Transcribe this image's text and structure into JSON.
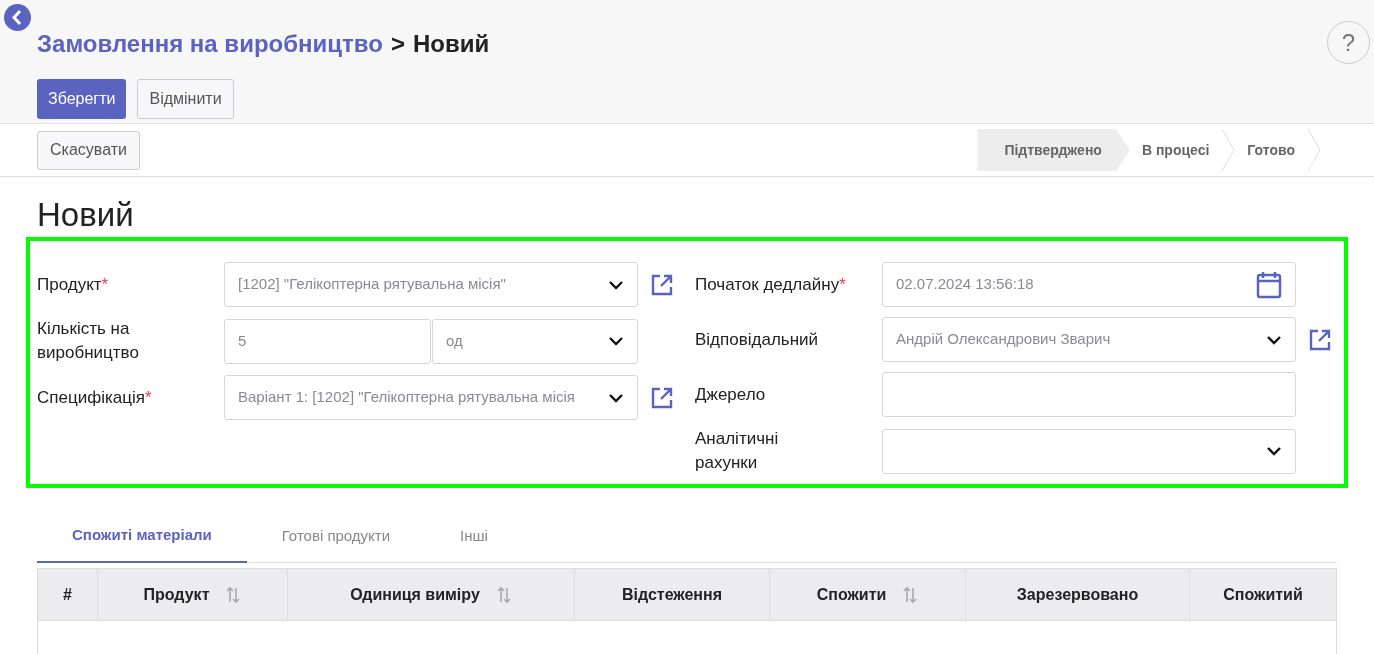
{
  "breadcrumb": {
    "parent": "Замовлення на виробництво",
    "separator": ">",
    "current": "Новий"
  },
  "help": "?",
  "required_mark": "*",
  "actions": [
    {
      "label": "Зберегти",
      "primary": true
    },
    {
      "label": "Відмінити",
      "primary": false
    }
  ],
  "cancel_button": "Скасувати",
  "statuses": [
    {
      "label": "Підтверджено",
      "selected": true
    },
    {
      "label": "В процесі",
      "selected": false
    },
    {
      "label": "Готово",
      "selected": false
    }
  ],
  "title": "Новий",
  "left_fields": [
    {
      "label": "Продукт",
      "required": true,
      "kind": "select",
      "value": "[1202] \"Гелікоптерна рятувальна місія\"",
      "link": true
    },
    {
      "label": "Кількість на\nвиробництво",
      "required": false,
      "kind": "qty",
      "value": "5",
      "unit": "од",
      "link": false
    },
    {
      "label": "Специфікація",
      "required": true,
      "kind": "select",
      "value": "Варіант 1: [1202] \"Гелікоптерна рятувальна місія",
      "link": true
    }
  ],
  "right_fields": [
    {
      "label": "Початок дедлайну",
      "required": true,
      "kind": "date",
      "value": "02.07.2024 13:56:18",
      "link": false
    },
    {
      "label": "Відповідальний",
      "required": false,
      "kind": "select",
      "value": "Андрій Олександрович Зварич",
      "link": true
    },
    {
      "label": "Джерело",
      "required": false,
      "kind": "text",
      "link": false
    },
    {
      "label": "Аналітичні\nрахунки",
      "required": false,
      "kind": "select",
      "link": false
    }
  ],
  "tabs": [
    {
      "label": "Спожиті матеріали",
      "selected": true
    },
    {
      "label": "Готові продукти",
      "selected": false
    },
    {
      "label": "Інші",
      "selected": false
    }
  ],
  "table": {
    "columns": [
      {
        "label": "#",
        "sortable": false
      },
      {
        "label": "Продукт",
        "sortable": true
      },
      {
        "label": "Одиниця виміру",
        "sortable": true
      },
      {
        "label": "Відстеження",
        "sortable": false
      },
      {
        "label": "Спожити",
        "sortable": true
      },
      {
        "label": "Зарезервовано",
        "sortable": false
      },
      {
        "label": "Спожитий",
        "sortable": false
      }
    ]
  }
}
